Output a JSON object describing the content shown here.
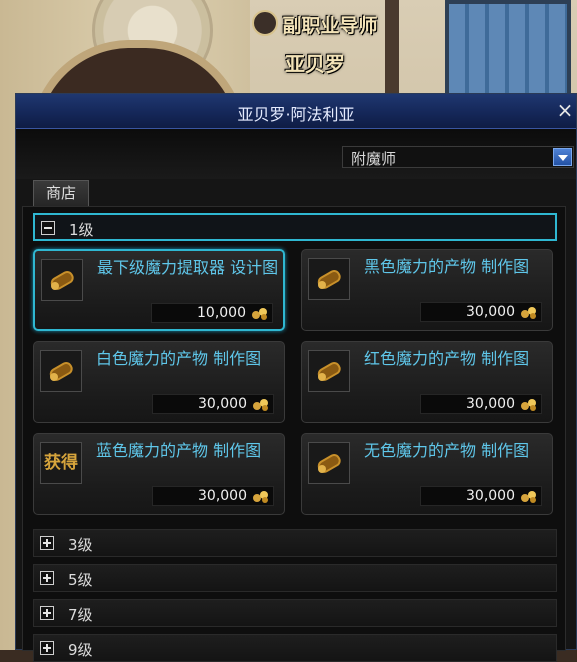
{
  "npc": {
    "title": "副职业导师",
    "name": "亚贝罗"
  },
  "window": {
    "title": "亚贝罗·阿法利亚",
    "close_glyph": "×",
    "dropdown_value": "附魔师",
    "tab_label": "商店"
  },
  "levels": [
    {
      "label": "1级",
      "expanded": true
    },
    {
      "label": "3级",
      "expanded": false
    },
    {
      "label": "5级",
      "expanded": false
    },
    {
      "label": "7级",
      "expanded": false
    },
    {
      "label": "9级",
      "expanded": false
    }
  ],
  "items": [
    {
      "name": "最下级魔力提取器  设计图",
      "price": "10,000",
      "icon": "scroll-icon",
      "selected": true
    },
    {
      "name": "黑色魔力的产物 制作图",
      "price": "30,000",
      "icon": "scroll-icon",
      "selected": false
    },
    {
      "name": "白色魔力的产物 制作图",
      "price": "30,000",
      "icon": "scroll-icon",
      "selected": false
    },
    {
      "name": "红色魔力的产物 制作图",
      "price": "30,000",
      "icon": "scroll-icon",
      "selected": false
    },
    {
      "name": "蓝色魔力的产物 制作图",
      "price": "30,000",
      "icon": "obtain-icon",
      "icon_text": "获得",
      "selected": false
    },
    {
      "name": "无色魔力的产物 制作图",
      "price": "30,000",
      "icon": "scroll-icon",
      "selected": false
    }
  ],
  "colors": {
    "accent_cyan": "#2fb7d1",
    "item_name": "#5fc7ea",
    "gold": "#d6a43c"
  }
}
